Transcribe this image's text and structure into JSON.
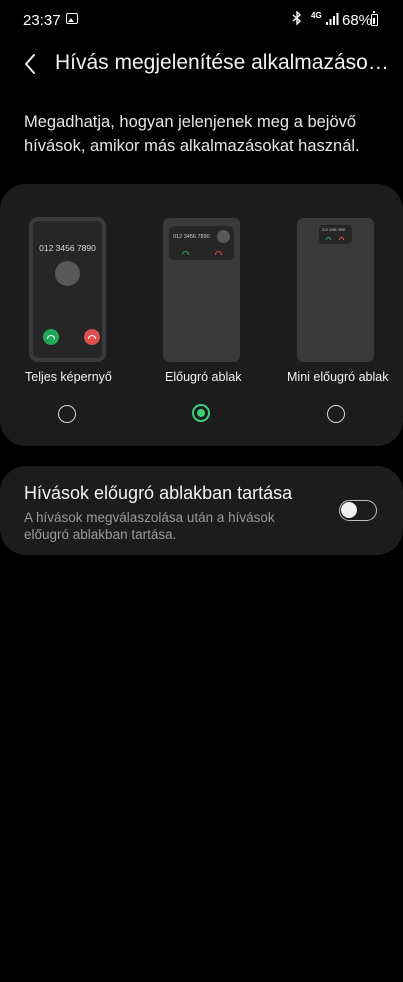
{
  "status_bar": {
    "time": "23:37",
    "network": "4G",
    "battery": "68%",
    "icons": [
      "gallery-icon",
      "bluetooth-icon",
      "signal-icon",
      "battery-icon"
    ]
  },
  "header": {
    "title": "Hívás megjelenítése alkalmazások…"
  },
  "description": "Megadhatja, hogyan jelenjenek meg a bejövő hívások, amikor más alkalmazásokat használ.",
  "options": [
    {
      "label": "Teljes képernyő",
      "preview_number": "012 3456 7890",
      "selected": false
    },
    {
      "label": "Előugró ablak",
      "preview_number": "012 3456 7890",
      "selected": true
    },
    {
      "label": "Mini előugró ablak",
      "preview_number": "012 3456 7890",
      "selected": false
    }
  ],
  "setting": {
    "title": "Hívások előugró ablakban tartása",
    "subtitle": "A hívások megválaszolása után a hívások előugró ablakban tartása.",
    "enabled": false
  },
  "colors": {
    "background": "#000000",
    "card": "#1c1c1c",
    "accent": "#3ad17a",
    "answer": "#1fa95b",
    "decline": "#e05050"
  }
}
